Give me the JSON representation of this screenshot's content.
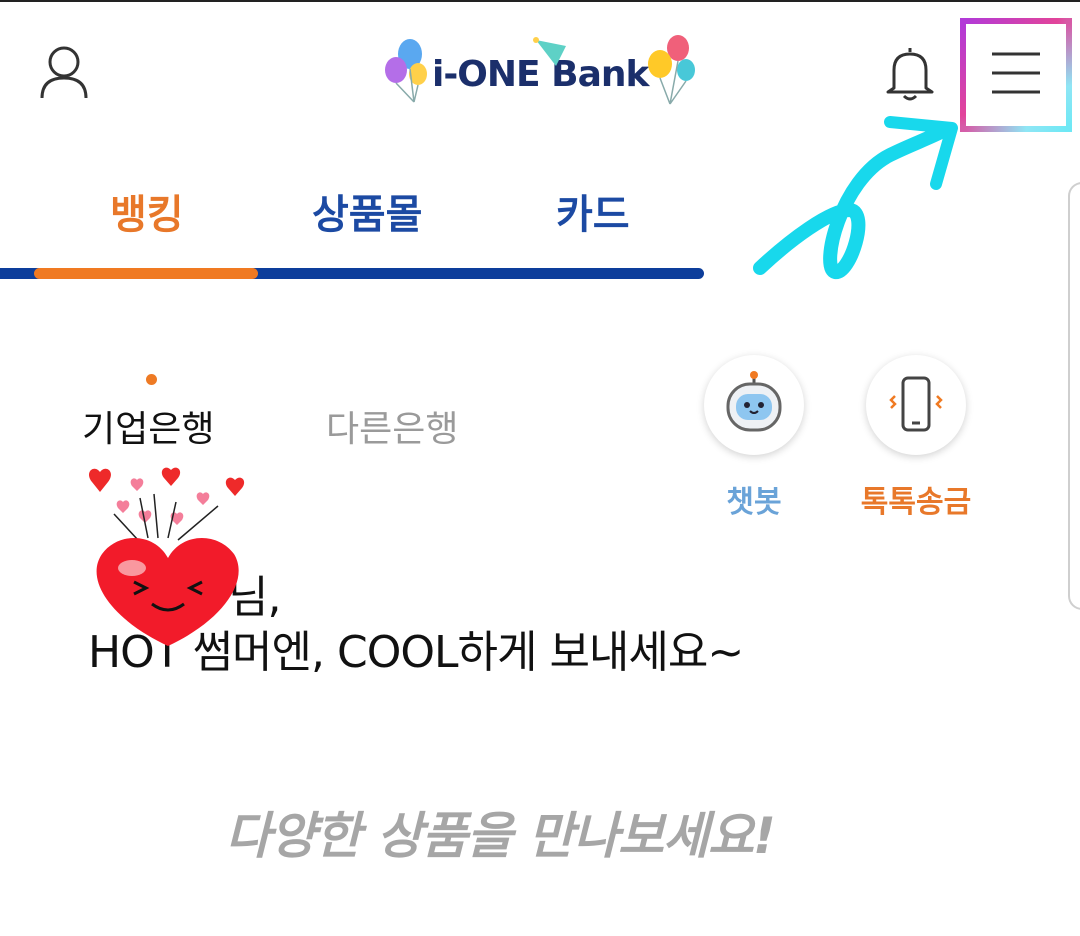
{
  "header": {
    "user_icon": "user-icon",
    "logo_text": "i-ONE Bank",
    "bell_icon": "bell-icon",
    "menu_icon": "hamburger-menu-icon"
  },
  "tabs": [
    {
      "label": "뱅킹",
      "active": true
    },
    {
      "label": "상품몰",
      "active": false
    },
    {
      "label": "카드",
      "active": false
    }
  ],
  "bank_tabs": {
    "ibk": "기업은행",
    "other": "다른은행"
  },
  "quick_actions": {
    "chatbot": {
      "label": "챗봇",
      "icon": "chatbot-robot-icon"
    },
    "talk": {
      "label": "톡톡송금",
      "icon": "phone-vibrate-icon"
    }
  },
  "greeting": {
    "line1": "님,",
    "line2": "HOT 썸머엔, COOL하게 보내세요~"
  },
  "promo": {
    "text": "다양한 상품을 만나보세요!"
  },
  "colors": {
    "orange": "#f07a22",
    "navy": "#0d3e9b",
    "chatbot_label": "#6aa3d8",
    "doodle_cyan": "#18d8ec"
  }
}
